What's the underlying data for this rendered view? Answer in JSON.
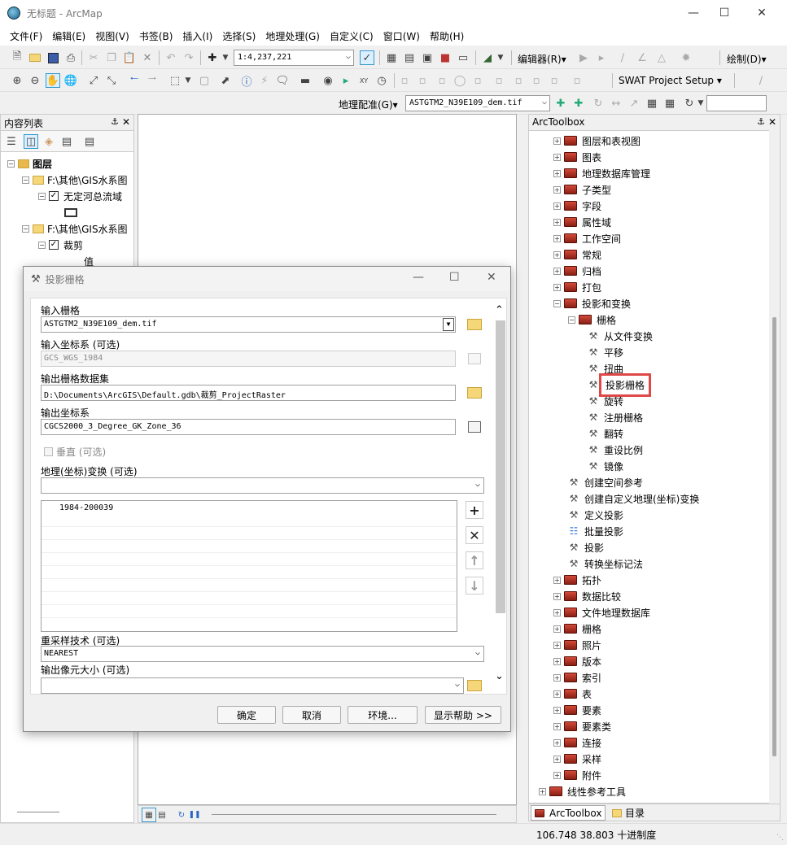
{
  "window": {
    "title": "无标题 - ArcMap"
  },
  "menu": [
    "文件(F)",
    "编辑(E)",
    "视图(V)",
    "书签(B)",
    "插入(I)",
    "选择(S)",
    "地理处理(G)",
    "自定义(C)",
    "窗口(W)",
    "帮助(H)"
  ],
  "toolbar": {
    "scale": "1:4,237,221",
    "editor": "编辑器(R)▾",
    "draw": "绘制(D)▾",
    "swat": "SWAT Project Setup ▾",
    "georef": "地理配准(G)▾",
    "georef_layer": "ASTGTM2_N39E109_dem.tif"
  },
  "toc": {
    "title": "内容列表",
    "items": [
      {
        "label": "图层",
        "level": 0
      },
      {
        "label": "F:\\其他\\GIS水系图",
        "level": 1
      },
      {
        "label": "无定河总流域",
        "level": 2
      },
      {
        "label": "F:\\其他\\GIS水系图",
        "level": 1
      },
      {
        "label": "裁剪",
        "level": 2
      },
      {
        "label": "值",
        "level": 3
      }
    ]
  },
  "arctoolbox": {
    "title": "ArcToolbox",
    "items": [
      {
        "label": "图层和表视图",
        "type": "toolbox",
        "level": 1
      },
      {
        "label": "图表",
        "type": "toolbox",
        "level": 1
      },
      {
        "label": "地理数据库管理",
        "type": "toolbox",
        "level": 1
      },
      {
        "label": "子类型",
        "type": "toolbox",
        "level": 1
      },
      {
        "label": "字段",
        "type": "toolbox",
        "level": 1
      },
      {
        "label": "属性域",
        "type": "toolbox",
        "level": 1
      },
      {
        "label": "工作空间",
        "type": "toolbox",
        "level": 1
      },
      {
        "label": "常规",
        "type": "toolbox",
        "level": 1
      },
      {
        "label": "归档",
        "type": "toolbox",
        "level": 1
      },
      {
        "label": "打包",
        "type": "toolbox",
        "level": 1
      },
      {
        "label": "投影和变换",
        "type": "toolbox",
        "level": 1,
        "expanded": true
      },
      {
        "label": "栅格",
        "type": "toolbox",
        "level": 2,
        "expanded": true
      },
      {
        "label": "从文件变换",
        "type": "tool",
        "level": 3
      },
      {
        "label": "平移",
        "type": "tool",
        "level": 3
      },
      {
        "label": "扭曲",
        "type": "tool",
        "level": 3
      },
      {
        "label": "投影栅格",
        "type": "tool",
        "level": 3,
        "highlighted": true
      },
      {
        "label": "旋转",
        "type": "tool",
        "level": 3
      },
      {
        "label": "注册栅格",
        "type": "tool",
        "level": 3
      },
      {
        "label": "翻转",
        "type": "tool",
        "level": 3
      },
      {
        "label": "重设比例",
        "type": "tool",
        "level": 3
      },
      {
        "label": "镜像",
        "type": "tool",
        "level": 3
      },
      {
        "label": "创建空间参考",
        "type": "tool",
        "level": 2
      },
      {
        "label": "创建自定义地理(坐标)变换",
        "type": "tool",
        "level": 2
      },
      {
        "label": "定义投影",
        "type": "tool",
        "level": 2
      },
      {
        "label": "批量投影",
        "type": "script",
        "level": 2
      },
      {
        "label": "投影",
        "type": "tool",
        "level": 2
      },
      {
        "label": "转换坐标记法",
        "type": "tool",
        "level": 2
      },
      {
        "label": "拓扑",
        "type": "toolbox",
        "level": 1
      },
      {
        "label": "数据比较",
        "type": "toolbox",
        "level": 1
      },
      {
        "label": "文件地理数据库",
        "type": "toolbox",
        "level": 1
      },
      {
        "label": "栅格",
        "type": "toolbox",
        "level": 1
      },
      {
        "label": "照片",
        "type": "toolbox",
        "level": 1
      },
      {
        "label": "版本",
        "type": "toolbox",
        "level": 1
      },
      {
        "label": "索引",
        "type": "toolbox",
        "level": 1
      },
      {
        "label": "表",
        "type": "toolbox",
        "level": 1
      },
      {
        "label": "要素",
        "type": "toolbox",
        "level": 1
      },
      {
        "label": "要素类",
        "type": "toolbox",
        "level": 1
      },
      {
        "label": "连接",
        "type": "toolbox",
        "level": 1
      },
      {
        "label": "采样",
        "type": "toolbox",
        "level": 1
      },
      {
        "label": "附件",
        "type": "toolbox",
        "level": 1
      },
      {
        "label": "线性参考工具",
        "type": "toolbox",
        "level": 0
      }
    ],
    "tabs": [
      "ArcToolbox",
      "目录"
    ]
  },
  "dialog": {
    "title": "投影栅格",
    "input_raster_label": "输入栅格",
    "input_raster": "ASTGTM2_N39E109_dem.tif",
    "input_crs_label": "输入坐标系 (可选)",
    "input_crs": "GCS_WGS_1984",
    "output_dataset_label": "输出栅格数据集",
    "output_dataset": "D:\\Documents\\ArcGIS\\Default.gdb\\裁剪_ProjectRaster",
    "output_crs_label": "输出坐标系",
    "output_crs": "CGCS2000_3_Degree_GK_Zone_36",
    "vertical_label": "垂直 (可选)",
    "geo_transform_label": "地理(坐标)变换 (可选)",
    "geo_transform_list": [
      "1984-200039"
    ],
    "resample_label": "重采样技术 (可选)",
    "resample": "NEAREST",
    "cellsize_label": "输出像元大小 (可选)",
    "buttons": {
      "ok": "确定",
      "cancel": "取消",
      "env": "环境...",
      "help": "显示帮助 >>"
    }
  },
  "status": {
    "coords": "106.748  38.803 十进制度"
  }
}
